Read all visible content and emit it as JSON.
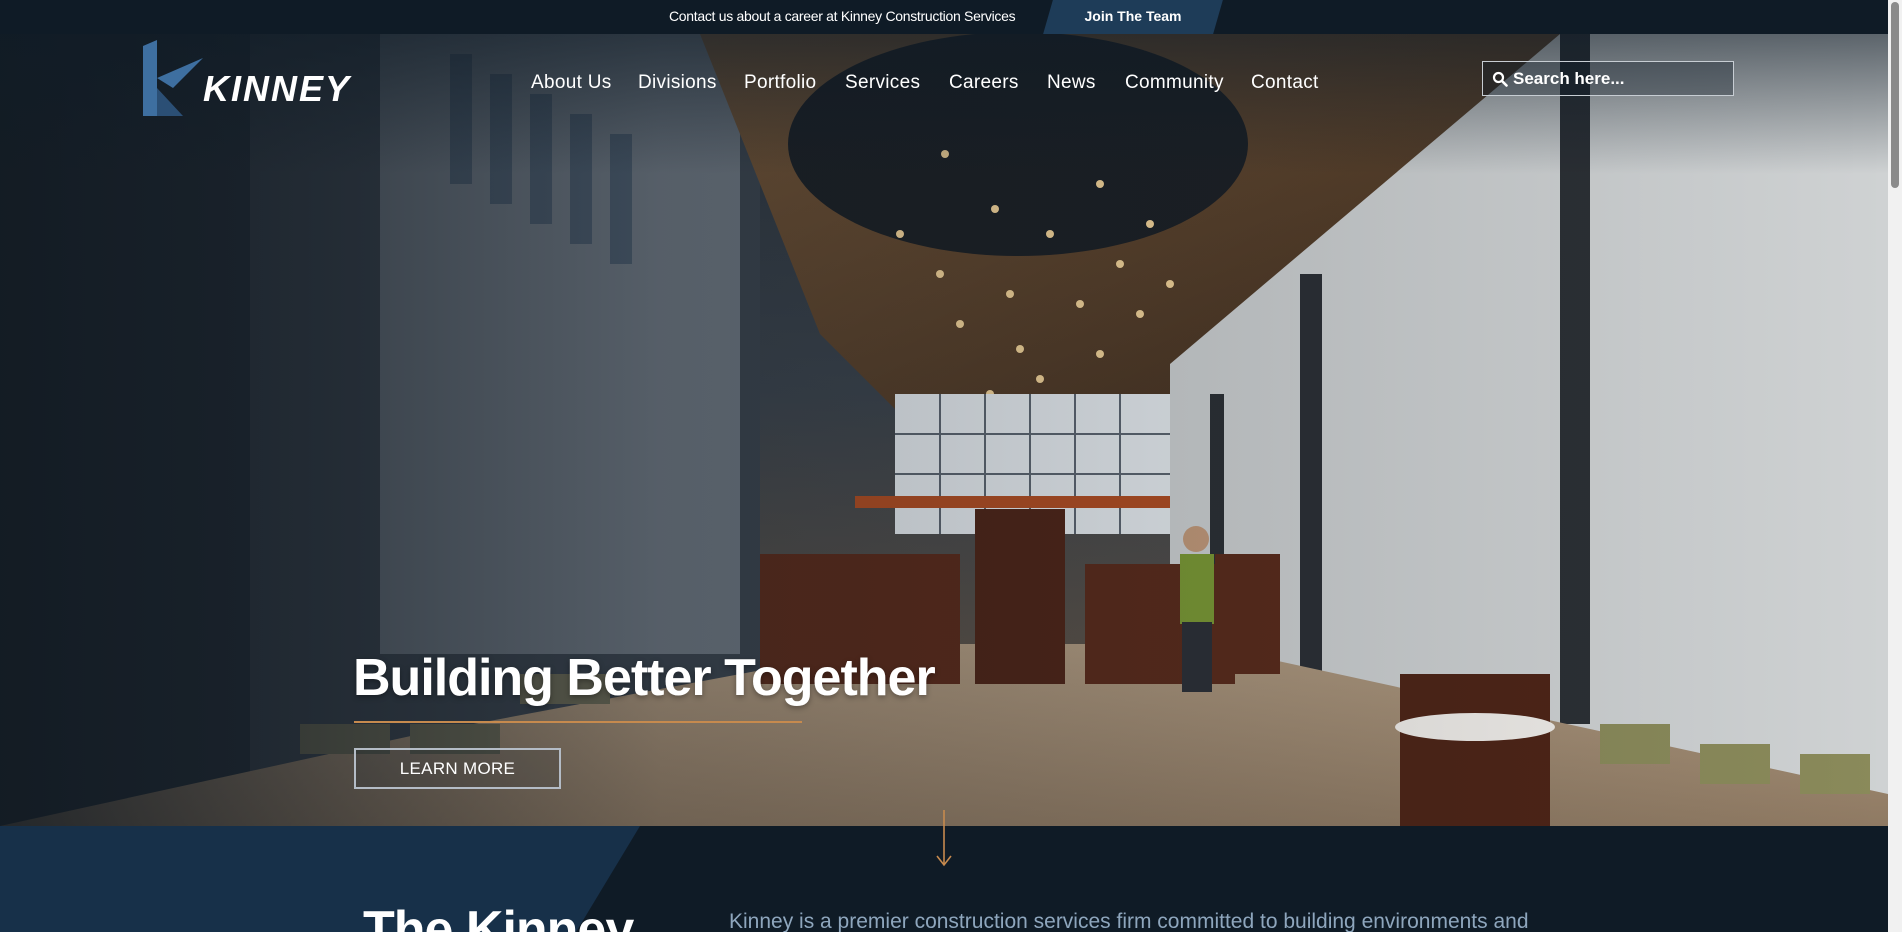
{
  "topbar": {
    "message": "Contact us about a career at Kinney Construction Services",
    "join_label": "Join The Team"
  },
  "logo": {
    "text": "KINNEY"
  },
  "nav": {
    "items": [
      {
        "label": "About Us"
      },
      {
        "label": "Divisions"
      },
      {
        "label": "Portfolio"
      },
      {
        "label": "Services"
      },
      {
        "label": "Careers"
      },
      {
        "label": "News"
      },
      {
        "label": "Community"
      },
      {
        "label": "Contact"
      }
    ]
  },
  "search": {
    "placeholder": "Search here...",
    "value": "",
    "icon": "search-icon"
  },
  "hero": {
    "headline": "Building Better Together",
    "cta_label": "LEARN MORE",
    "scroll_icon": "arrow-down-icon"
  },
  "intro": {
    "title": "The Kinney",
    "text": "Kinney is a premier construction services firm committed to building environments and"
  },
  "colors": {
    "background": "#0f1b26",
    "join_button": "#1e3c58",
    "accent": "#c68a4e",
    "intro_text": "#8ea6bd",
    "logo_blue": "#3e6fa0"
  }
}
